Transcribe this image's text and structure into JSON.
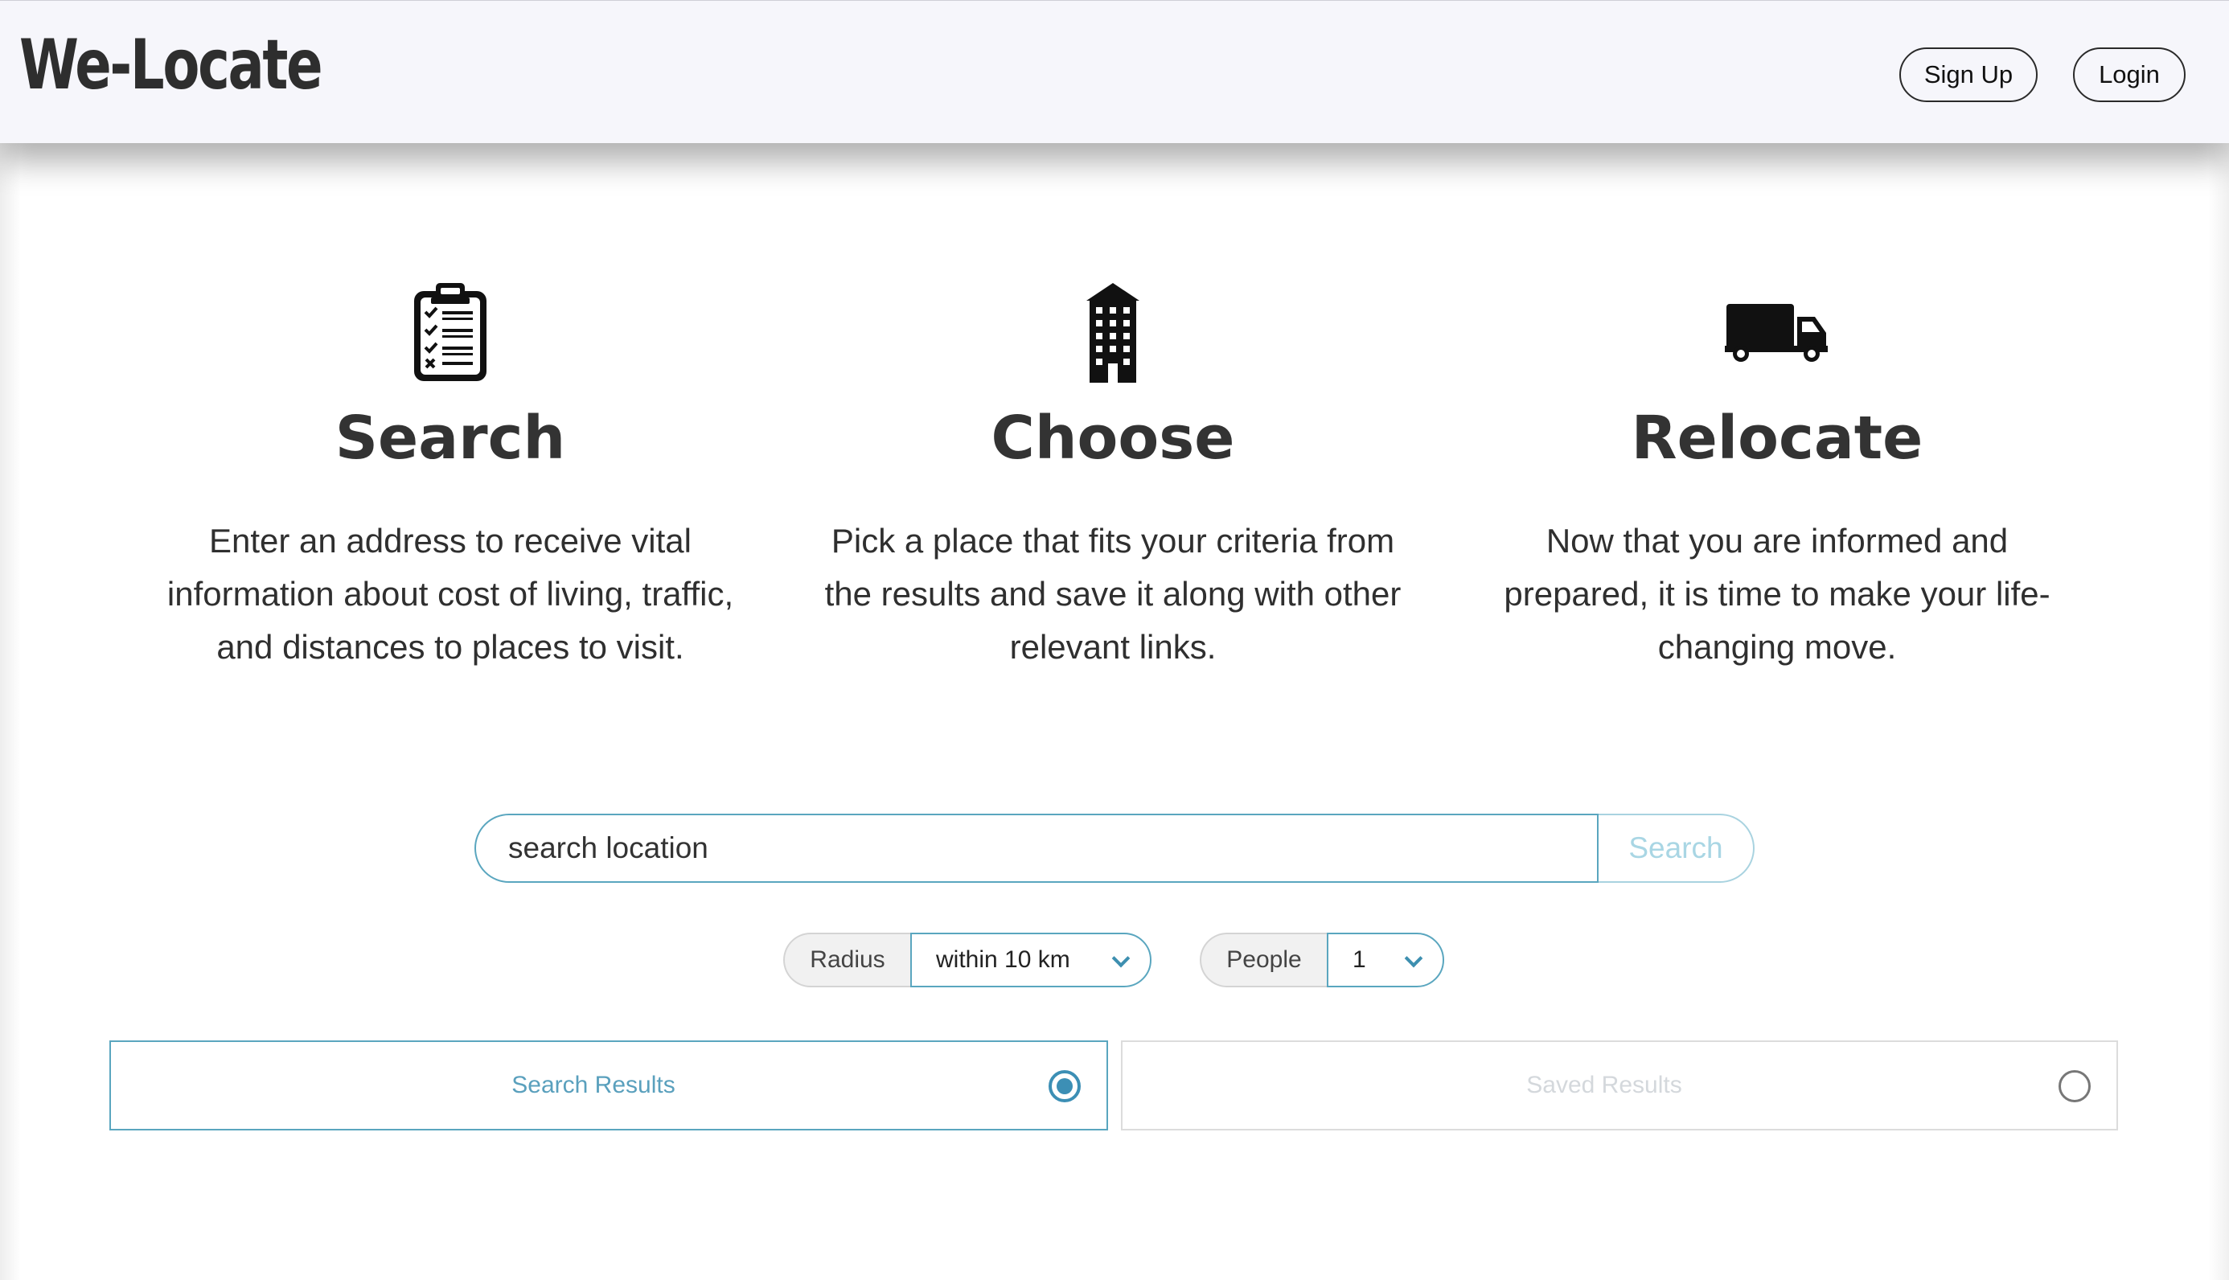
{
  "header": {
    "brand": "We-Locate",
    "signup_label": "Sign Up",
    "login_label": "Login"
  },
  "features": [
    {
      "icon": "clipboard-checklist-icon",
      "title": "Search",
      "text": "Enter an address to receive vital information about cost of living, traffic, and distances to places to visit."
    },
    {
      "icon": "building-icon",
      "title": "Choose",
      "text": "Pick a place that fits your criteria from the results and save it along with other relevant links."
    },
    {
      "icon": "truck-icon",
      "title": "Relocate",
      "text": "Now that you are informed and prepared, it is time to make your life-changing move."
    }
  ],
  "search": {
    "placeholder": "search location",
    "button_label": "Search"
  },
  "filters": {
    "radius": {
      "label": "Radius",
      "value": "within 10 km"
    },
    "people": {
      "label": "People",
      "value": "1"
    }
  },
  "tabs": {
    "search_results": {
      "label": "Search Results",
      "selected": true
    },
    "saved_results": {
      "label": "Saved Results",
      "selected": false
    }
  },
  "colors": {
    "accent": "#5aa6bf",
    "radio_accent": "#3c8fb5",
    "header_bg": "#f6f6fb",
    "text": "#2f2f2f"
  }
}
